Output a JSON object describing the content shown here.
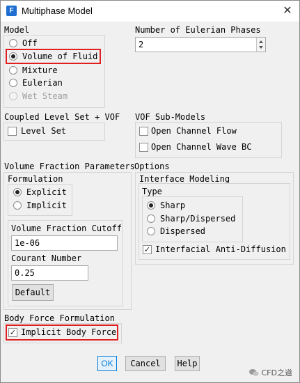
{
  "window": {
    "app_icon": "F",
    "title": "Multiphase Model",
    "close_glyph": "✕"
  },
  "model": {
    "label": "Model",
    "options": [
      "Off",
      "Volume of Fluid",
      "Mixture",
      "Eulerian",
      "Wet Steam"
    ],
    "selected": "Volume of Fluid",
    "disabled": [
      "Wet Steam"
    ]
  },
  "eulerian_phases": {
    "label": "Number of Eulerian Phases",
    "value": "2"
  },
  "coupled_level_set": {
    "label": "Coupled Level Set + VOF",
    "level_set_label": "Level Set",
    "level_set_checked": false
  },
  "vof_sub_models": {
    "label": "VOF Sub-Models",
    "open_channel_flow": "Open Channel Flow",
    "open_channel_wave_bc": "Open Channel Wave BC"
  },
  "vfp": {
    "label": "Volume Fraction Parameters",
    "formulation_label": "Formulation",
    "explicit": "Explicit",
    "implicit": "Implicit",
    "selected": "Explicit",
    "cutoff_label": "Volume Fraction Cutoff",
    "cutoff_value": "1e-06",
    "courant_label": "Courant Number",
    "courant_value": "0.25",
    "default_button": "Default"
  },
  "options": {
    "label": "Options",
    "interface_modeling_label": "Interface Modeling",
    "type_label": "Type",
    "sharp": "Sharp",
    "sharp_dispersed": "Sharp/Dispersed",
    "dispersed": "Dispersed",
    "selected": "Sharp",
    "anti_diffusion": "Interfacial Anti-Diffusion",
    "anti_diffusion_checked": true
  },
  "body_force": {
    "label": "Body Force Formulation",
    "implicit_label": "Implicit Body Force",
    "checked": true
  },
  "buttons": {
    "ok": "OK",
    "cancel": "Cancel",
    "help": "Help"
  },
  "highlight_color": "#e02020",
  "watermark": {
    "icon": "wechat-icon",
    "text": "CFD之道"
  }
}
